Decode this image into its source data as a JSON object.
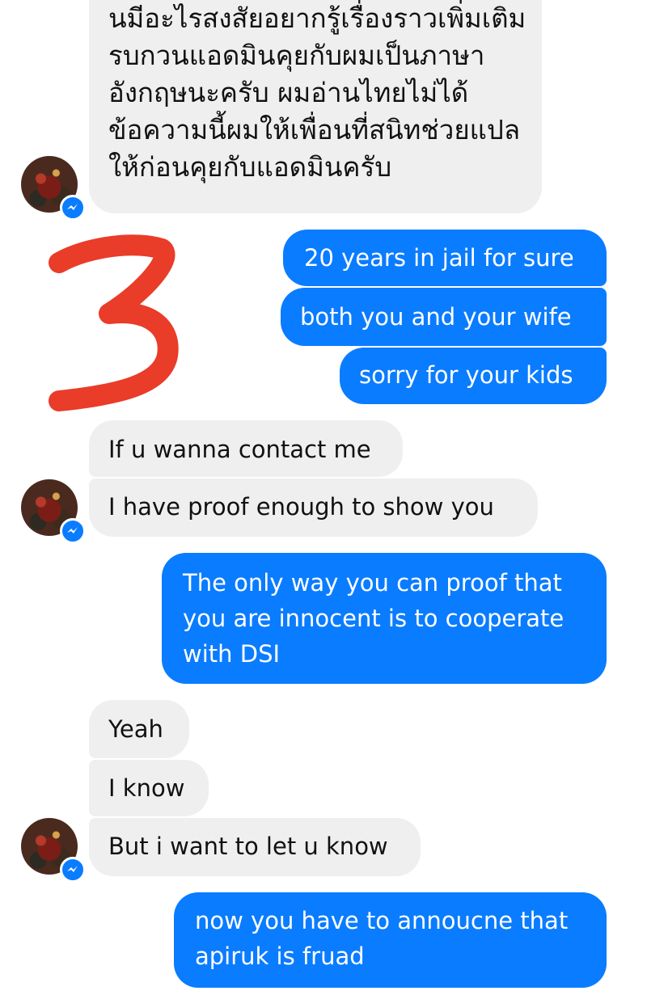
{
  "conversation": {
    "thai_message": [
      "นมีอะไรสงสัยอยากรู้เรื่องราวเพิ่มเติม",
      "รบกวนแอดมินคุยกับผมเป็นภาษา",
      "อังกฤษนะครับ ผมอ่านไทยไม่ได้",
      "ข้อความนี้ผมให้เพื่อนที่สนิทช่วยแปล",
      "ให้ก่อนคุยกับแอดมินครับ"
    ],
    "annotation_number": "3",
    "out1": "20 years in jail for sure",
    "out2": "both you and your wife",
    "out3": "sorry for your kids",
    "in1": "If u wanna contact me",
    "in2": "I have proof enough to show you",
    "out4": [
      "The only way you can proof that",
      "you are innocent is to cooperate",
      "with DSI"
    ],
    "in3": "Yeah",
    "in4": "I know",
    "in5": "But i want to let u know",
    "out5": [
      "now you have to annoucne that",
      "apiruk is fruad"
    ]
  },
  "colors": {
    "incoming_bubble": "#efefef",
    "outgoing_bubble": "#0a7cff",
    "annotation": "#e8321e"
  },
  "icons": {
    "avatar": "profile-photo",
    "badge": "messenger-icon"
  }
}
